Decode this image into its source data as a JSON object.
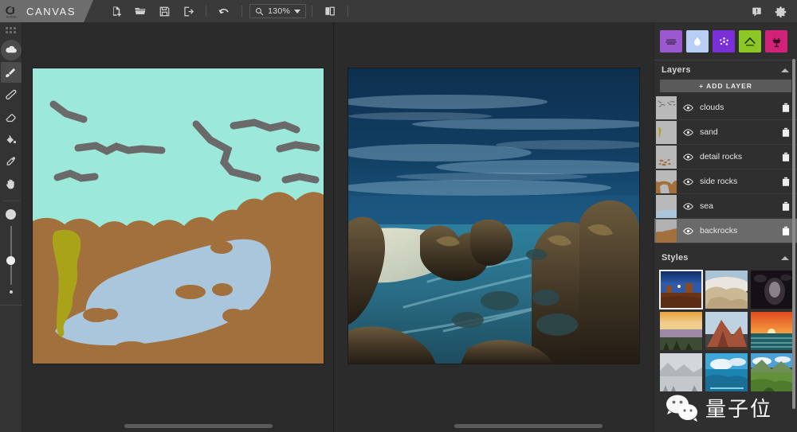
{
  "app": {
    "brand": "CANVAS",
    "logo_icon": "nvidia-logo"
  },
  "toolbar": {
    "buttons": [
      {
        "name": "new-file-button",
        "icon": "new-file-icon",
        "label": "New"
      },
      {
        "name": "open-file-button",
        "icon": "folder-open-icon",
        "label": "Open"
      },
      {
        "name": "save-file-button",
        "icon": "save-disk-icon",
        "label": "Save"
      },
      {
        "name": "export-button",
        "icon": "export-arrow-icon",
        "label": "Export"
      },
      {
        "name": "undo-button",
        "icon": "undo-arrow-icon",
        "label": "Undo"
      }
    ],
    "zoom": {
      "icon": "magnifier-icon",
      "value": "130%",
      "caret": "chevron-down-icon"
    },
    "view_mode": {
      "name": "split-view-button",
      "icon": "split-panel-icon",
      "label": "Split view"
    },
    "right_buttons": [
      {
        "name": "feedback-button",
        "icon": "feedback-bubble-icon",
        "label": "Feedback"
      },
      {
        "name": "settings-button",
        "icon": "gear-icon",
        "label": "Settings"
      }
    ]
  },
  "tools": {
    "items": [
      {
        "name": "tool-grid",
        "icon": "grid-dots-icon",
        "label": "Grid",
        "selected": false
      },
      {
        "name": "tool-cloud",
        "icon": "cloud-icon",
        "label": "Cloud",
        "selected": true
      },
      {
        "name": "tool-brush",
        "icon": "paintbrush-icon",
        "label": "Brush",
        "selected": true
      },
      {
        "name": "tool-pen",
        "icon": "pen-stroke-icon",
        "label": "Pen",
        "selected": false
      },
      {
        "name": "tool-eraser",
        "icon": "eraser-icon",
        "label": "Eraser",
        "selected": false
      },
      {
        "name": "tool-fill",
        "icon": "paint-bucket-icon",
        "label": "Fill",
        "selected": false
      },
      {
        "name": "tool-eyedropper",
        "icon": "eyedropper-icon",
        "label": "Eyedropper",
        "selected": false
      },
      {
        "name": "tool-pan",
        "icon": "hand-icon",
        "label": "Pan",
        "selected": false
      }
    ],
    "brush_size": {
      "max_icon": "large-dot",
      "min_icon": "small-dot",
      "slider": "brush-size-slider"
    }
  },
  "canvas": {
    "sketch": {
      "label": "Segmentation sketch",
      "sky_color": "#9ce8da",
      "rock_color": "#a1703c",
      "sea_color": "#a9c6dc",
      "sand_color": "#a8a319",
      "cloud_color": "#6a6a6a",
      "frame_color": "#1c1c1c"
    },
    "render": {
      "label": "AI rendered result",
      "sky_color": "#12436b",
      "sea_color": "#2c7c99",
      "rock_color": "#4a3a28"
    },
    "scrollbars": {
      "left_horizontal": "sketch-hscrollbar",
      "right_horizontal": "render-hscrollbar",
      "middle_vertical": "canvas-vscrollbar"
    }
  },
  "materials": {
    "label": "Material swatches",
    "items": [
      {
        "name": "material-ground",
        "color": "#9b59d0",
        "icon": "ground-lines-icon",
        "label": "Ground"
      },
      {
        "name": "material-water",
        "color": "#b8cef5",
        "icon": "water-drop-icon",
        "label": "Water"
      },
      {
        "name": "material-snow",
        "color": "#7b2fd6",
        "icon": "snow-sparkle-icon",
        "label": "Snow"
      },
      {
        "name": "material-mountain",
        "color": "#8bc825",
        "icon": "mountain-icon",
        "label": "Mountain"
      },
      {
        "name": "material-bush",
        "color": "#cf2278",
        "icon": "bush-icon",
        "label": "Bush"
      }
    ]
  },
  "layers_panel": {
    "title": "Layers",
    "collapse_icon": "chevron-up-icon",
    "add_layer_label": "+ ADD LAYER",
    "layers": [
      {
        "name": "clouds",
        "visible": true,
        "selected": false,
        "eye_icon": "eye-icon",
        "delete_icon": "trash-icon",
        "thumb": "clouds"
      },
      {
        "name": "sand",
        "visible": true,
        "selected": false,
        "eye_icon": "eye-icon",
        "delete_icon": "trash-icon",
        "thumb": "sand"
      },
      {
        "name": "detail rocks",
        "visible": true,
        "selected": false,
        "eye_icon": "eye-icon",
        "delete_icon": "trash-icon",
        "thumb": "detail-rocks"
      },
      {
        "name": "side rocks",
        "visible": true,
        "selected": false,
        "eye_icon": "eye-icon",
        "delete_icon": "trash-icon",
        "thumb": "side-rocks"
      },
      {
        "name": "sea",
        "visible": true,
        "selected": false,
        "eye_icon": "eye-icon",
        "delete_icon": "trash-icon",
        "thumb": "sea"
      },
      {
        "name": "backrocks",
        "visible": true,
        "selected": true,
        "eye_icon": "eye-icon",
        "delete_icon": "trash-icon",
        "thumb": "backrocks"
      }
    ]
  },
  "styles_panel": {
    "title": "Styles",
    "collapse_icon": "chevron-up-icon",
    "thumbnails": [
      {
        "name": "style-desert-night",
        "selected": true,
        "top": "#1d3f8a",
        "bottom": "#6b3418"
      },
      {
        "name": "style-white-rocks",
        "selected": false,
        "top": "#aac4d6",
        "bottom": "#c5b294"
      },
      {
        "name": "style-dark-cave",
        "selected": false,
        "top": "#17131a",
        "bottom": "#3e3740"
      },
      {
        "name": "style-golden-sunset",
        "selected": false,
        "top": "#e8a94a",
        "bottom": "#6e5f83"
      },
      {
        "name": "style-red-mountain",
        "selected": false,
        "top": "#b9cfe0",
        "bottom": "#8e4632"
      },
      {
        "name": "style-orange-sea",
        "selected": false,
        "top": "#e8572a",
        "bottom": "#1c5c66"
      },
      {
        "name": "style-gray-lake",
        "selected": false,
        "top": "#cfd4d6",
        "bottom": "#8f9698"
      },
      {
        "name": "style-blue-beach",
        "selected": false,
        "top": "#3aa6d8",
        "bottom": "#1a7fa8"
      },
      {
        "name": "style-green-valley",
        "selected": false,
        "top": "#4e9fd6",
        "bottom": "#5f8f35"
      }
    ]
  },
  "watermark": {
    "icon": "wechat-logo",
    "text": "量子位"
  }
}
